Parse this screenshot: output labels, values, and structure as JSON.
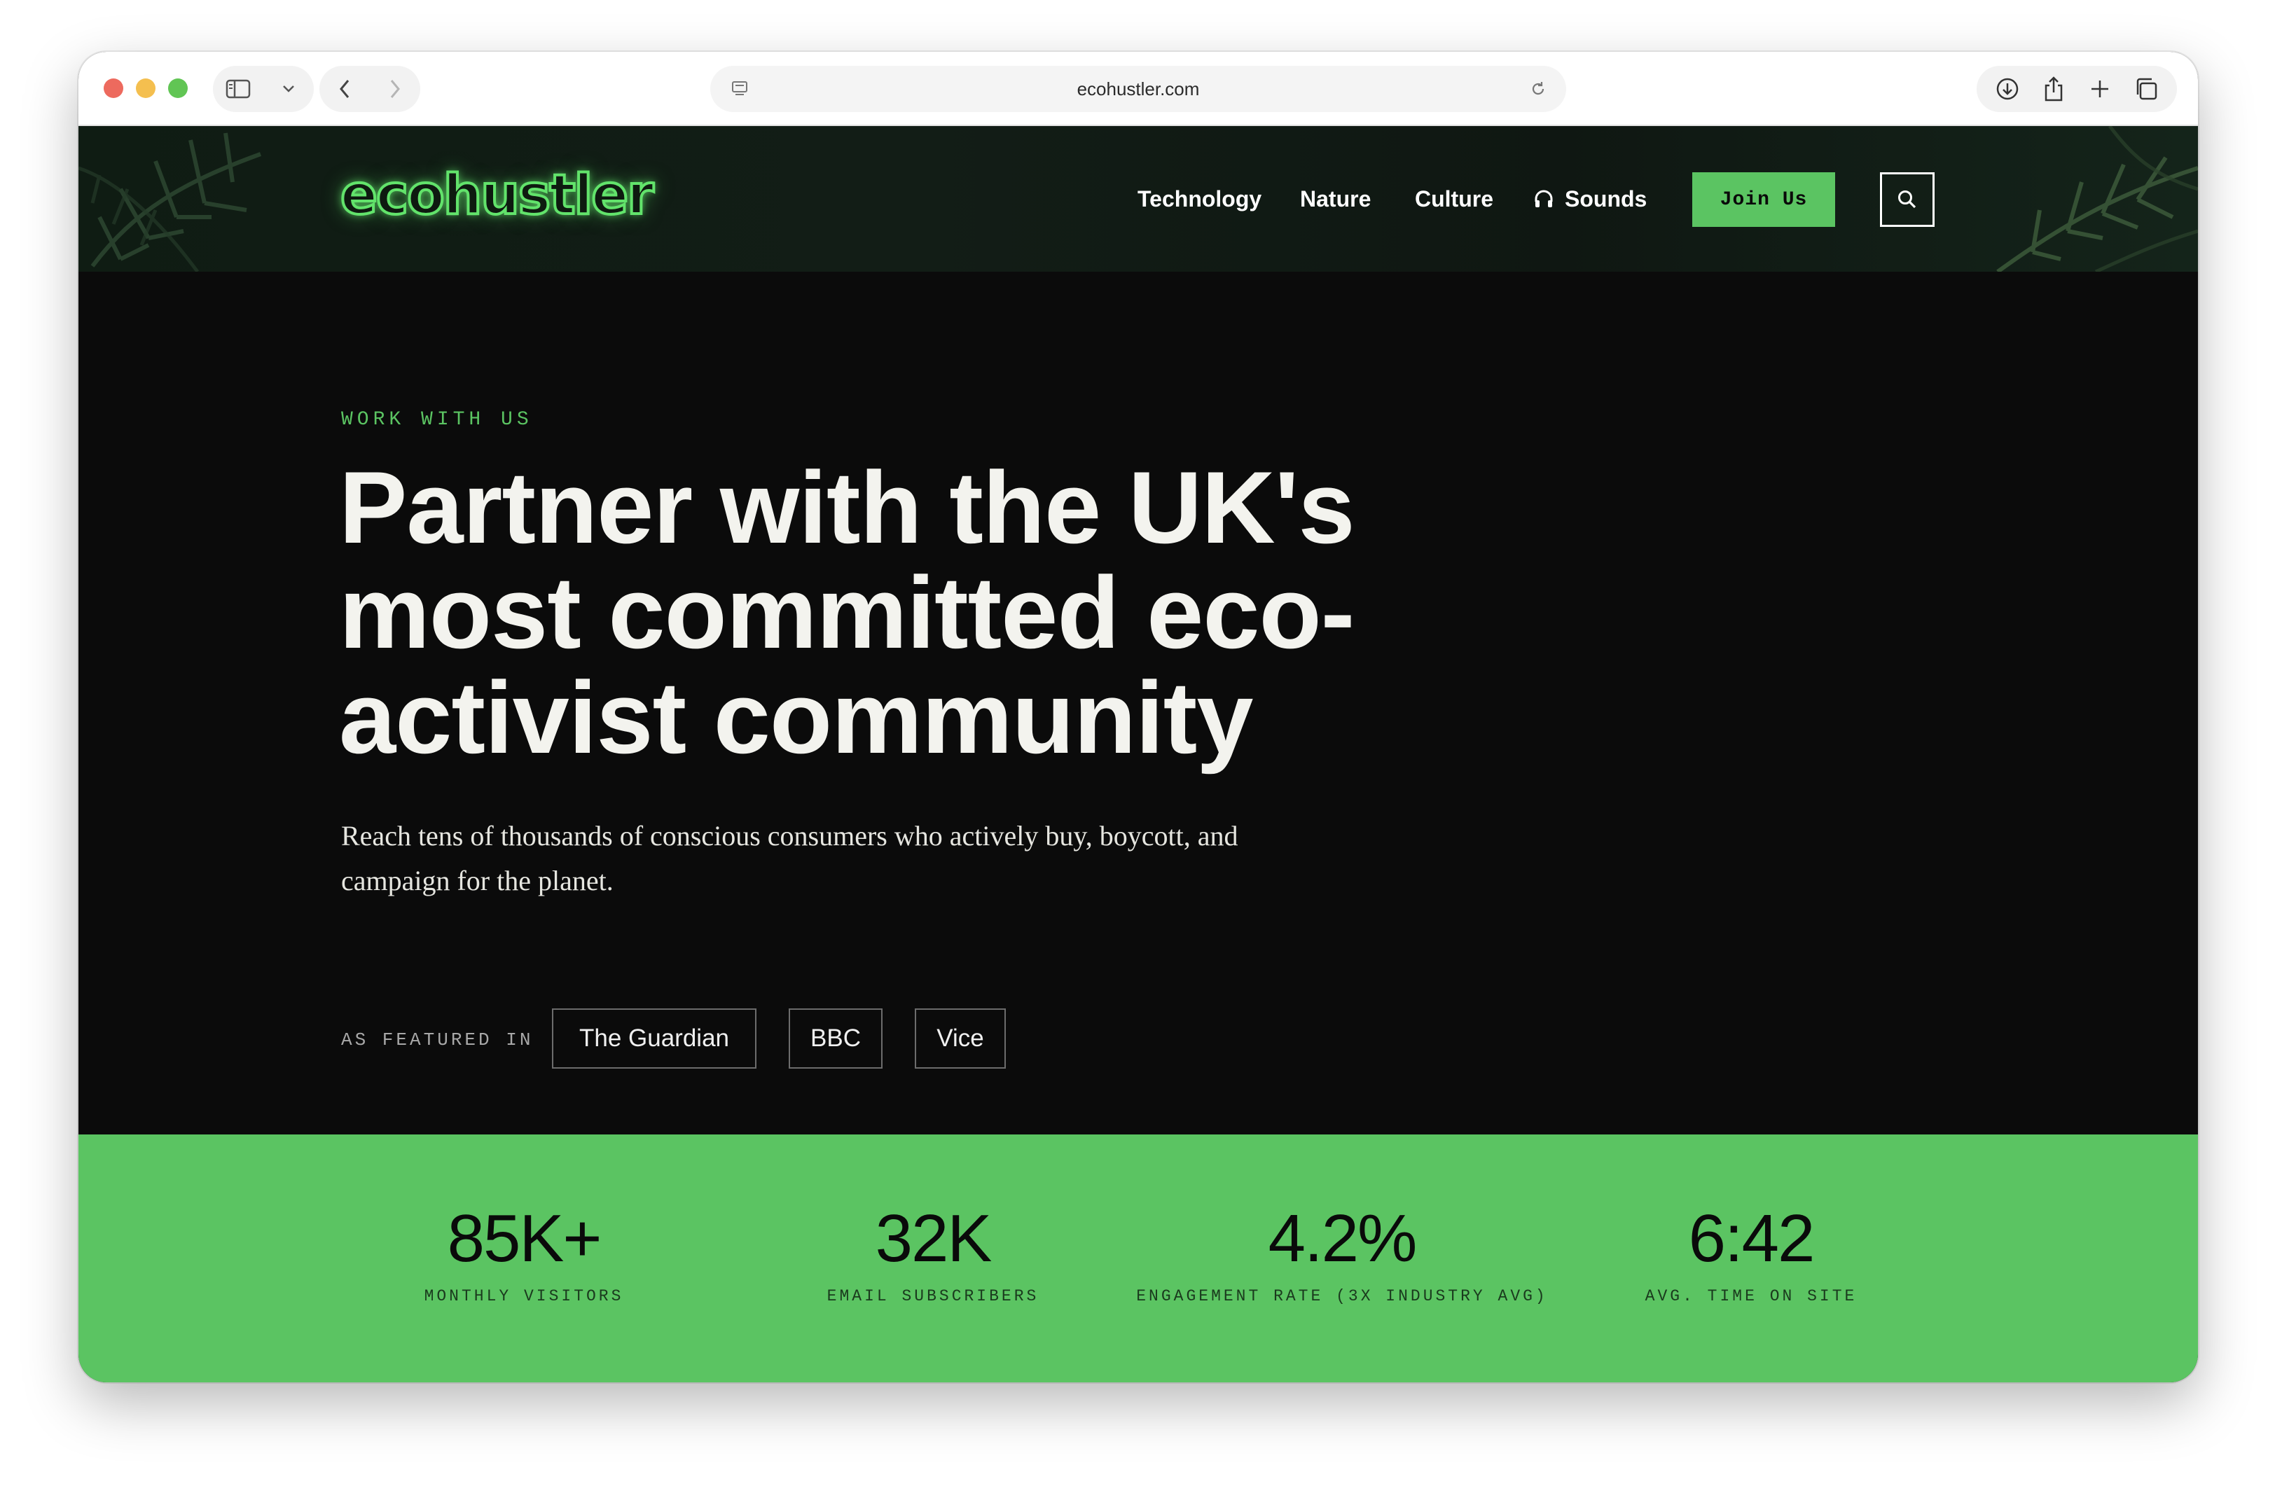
{
  "browser": {
    "url": "ecohustler.com",
    "icons": [
      "sidebar-icon",
      "chevron-down-icon",
      "back-icon",
      "forward-icon",
      "page-icon",
      "reload-icon",
      "download-icon",
      "share-icon",
      "new-tab-icon",
      "tabs-overview-icon"
    ]
  },
  "header": {
    "logo": "ecohustler",
    "nav": {
      "technology": "Technology",
      "nature": "Nature",
      "culture": "Culture",
      "sounds": "Sounds"
    },
    "join_label": "Join Us"
  },
  "hero": {
    "eyebrow": "WORK WITH US",
    "headline": "Partner with the UK's most committed eco-activist community",
    "subhead": "Reach tens of thousands of conscious consumers who actively buy, boycott, and campaign for the planet.",
    "featured_label": "AS FEATURED IN",
    "featured": [
      "The Guardian",
      "BBC",
      "Vice"
    ]
  },
  "stats": [
    {
      "value": "85K+",
      "label": "MONTHLY VISITORS"
    },
    {
      "value": "32K",
      "label": "EMAIL SUBSCRIBERS"
    },
    {
      "value": "4.2%",
      "label": "ENGAGEMENT RATE (3X INDUSTRY AVG)"
    },
    {
      "value": "6:42",
      "label": "AVG. TIME ON SITE"
    }
  ],
  "colors": {
    "accent_green": "#5bc462",
    "logo_glow": "#62e36b",
    "background_dark": "#0b0b0b",
    "text_light": "#f3f3ee"
  }
}
